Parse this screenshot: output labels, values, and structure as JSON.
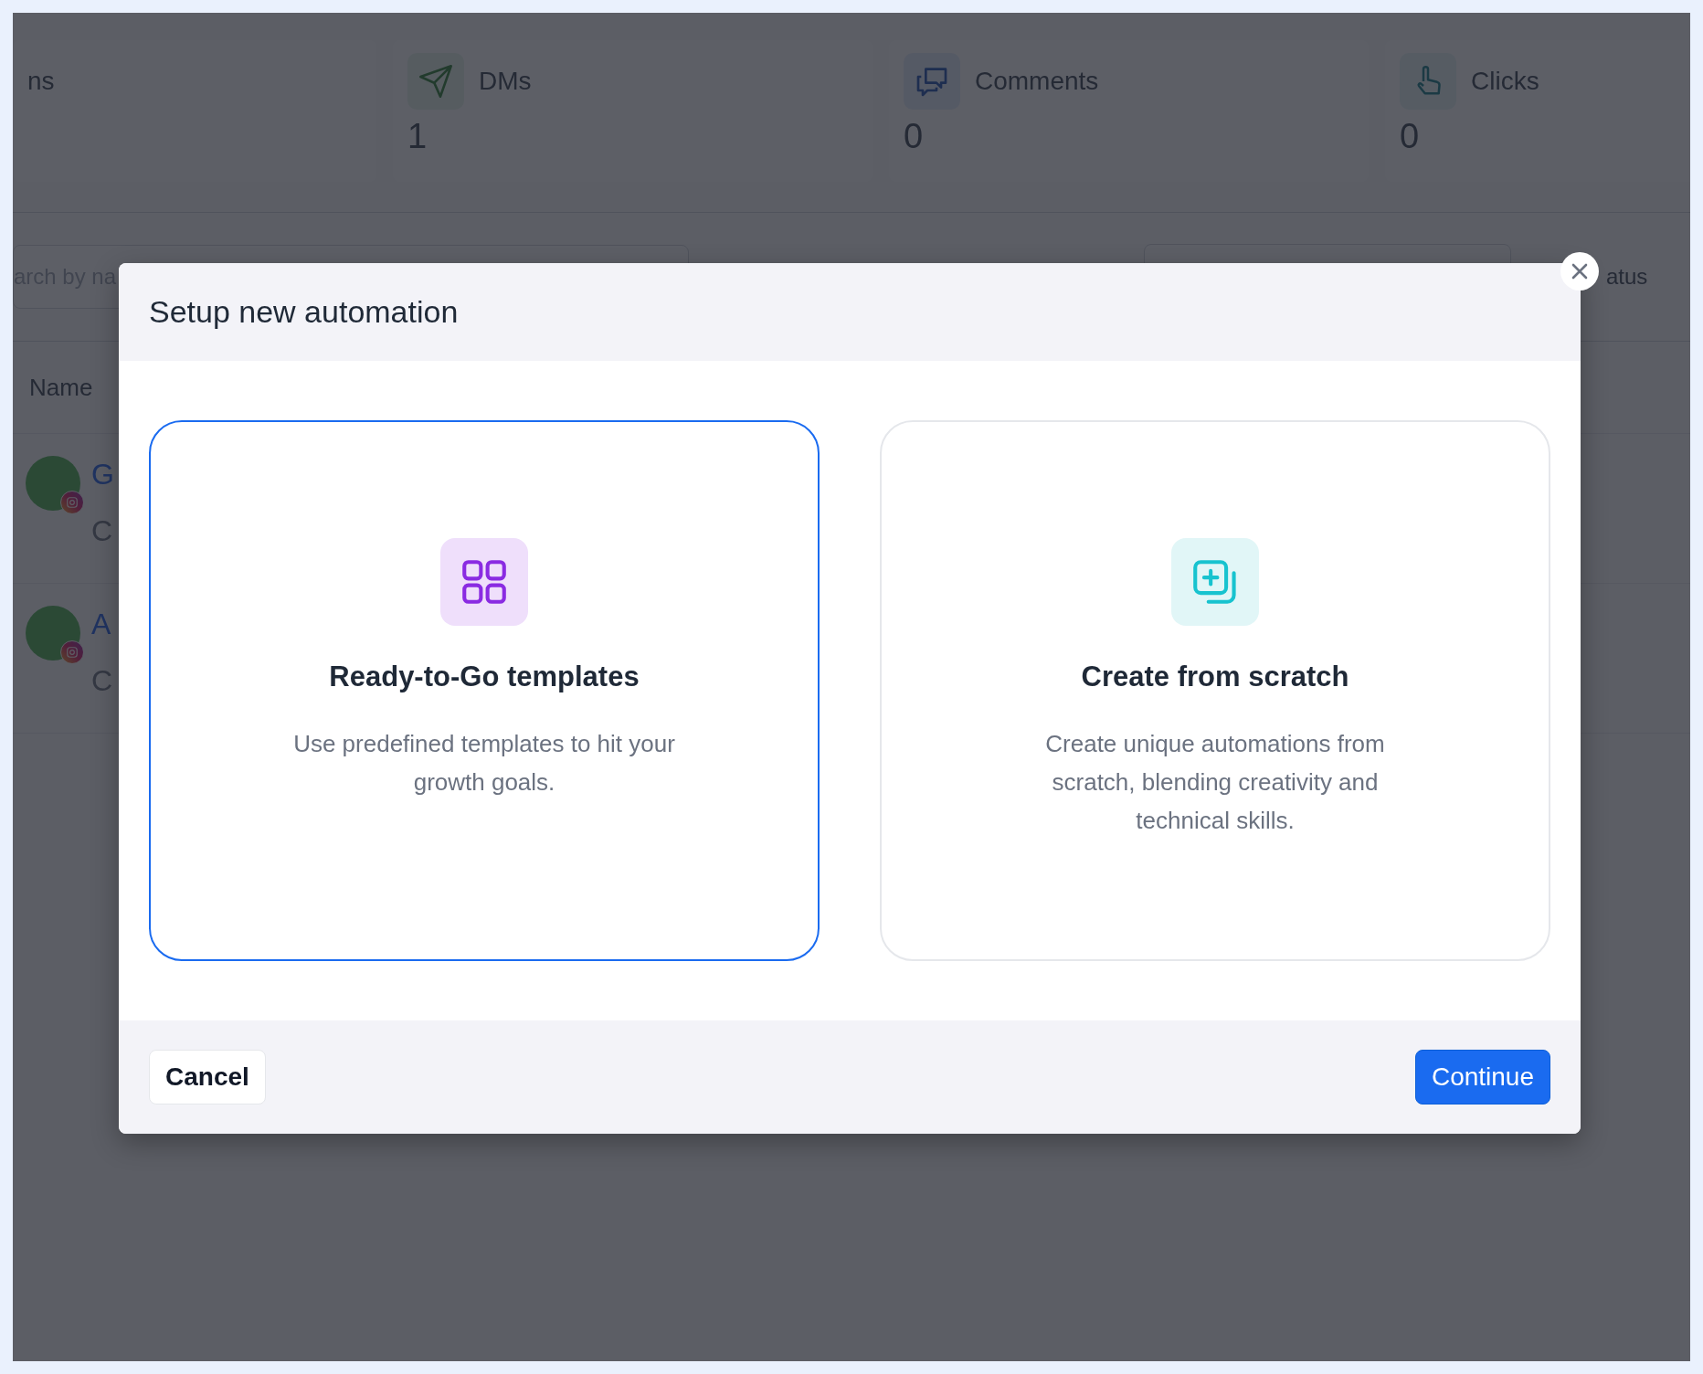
{
  "stats": [
    {
      "label": "ns",
      "kind": "plain"
    },
    {
      "label": "DMs",
      "value": "1",
      "kind": "dms"
    },
    {
      "label": "Comments",
      "value": "0",
      "kind": "comments"
    },
    {
      "label": "Clicks",
      "value": "0",
      "kind": "clicks"
    }
  ],
  "filters": {
    "search_placeholder": "arch by na",
    "status_label": "atus"
  },
  "table": {
    "column_1": "Name",
    "rows": [
      {
        "name": "G",
        "subtitle": "C"
      },
      {
        "name": "A",
        "subtitle": "C"
      }
    ]
  },
  "dialog": {
    "title": "Setup new automation",
    "options": [
      {
        "kind": "templates",
        "title": "Ready-to-Go templates",
        "description": "Use predefined templates to hit your growth goals.",
        "selected": true
      },
      {
        "kind": "scratch",
        "title": "Create from scratch",
        "description": "Create unique automations from scratch, blending creativity and technical skills.",
        "selected": false
      }
    ],
    "cancel": "Cancel",
    "continue": "Continue"
  }
}
